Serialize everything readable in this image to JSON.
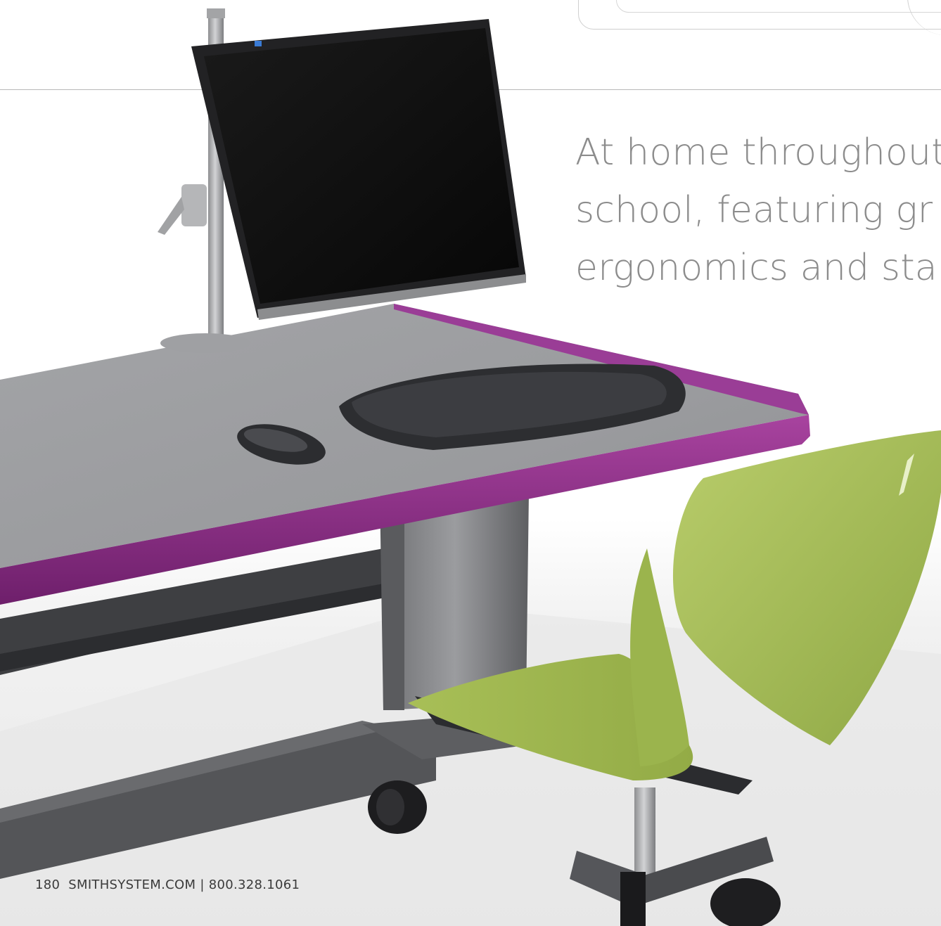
{
  "headline": {
    "line1": "At home throughout",
    "line2": "school, featuring gr",
    "line3": "ergonomics and sta"
  },
  "footer": {
    "page_number": "180",
    "site_and_phone": "SMITHSYSTEM.COM | 800.328.1061"
  },
  "colors": {
    "desk_edge": "#8e2f8c",
    "desktop_surface": "#9c9da0",
    "chair_shell": "#a9c05a",
    "frame": "#4a4a4a",
    "headline_text": "#8c8c8c"
  }
}
